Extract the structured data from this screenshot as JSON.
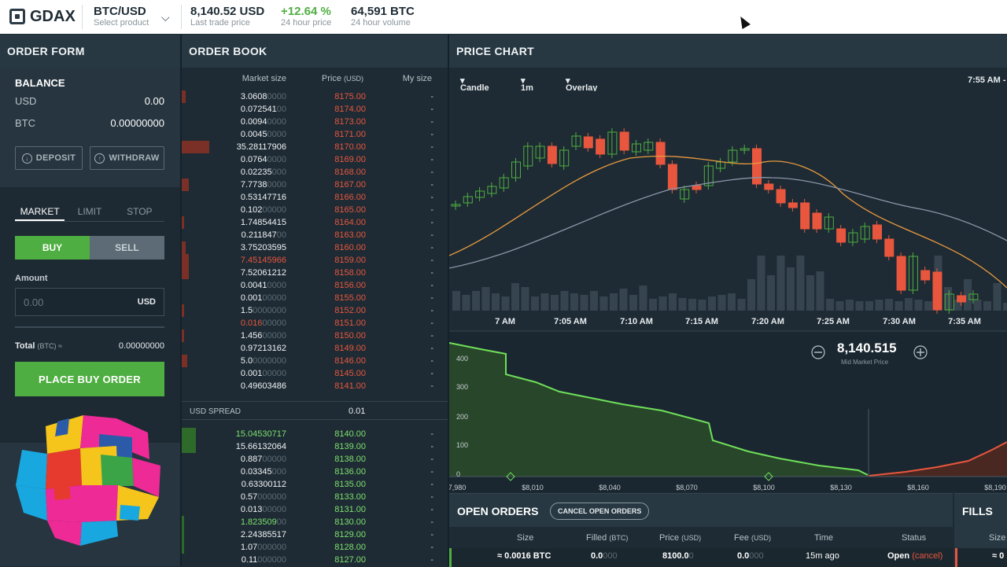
{
  "topbar": {
    "logo_text": "GDAX",
    "product": {
      "main": "BTC/USD",
      "sub": "Select product"
    },
    "last_price": {
      "main": "8,140.52 USD",
      "sub": "Last trade price"
    },
    "change": {
      "main": "+12.64 %",
      "sub": "24 hour price"
    },
    "volume": {
      "main": "64,591 BTC",
      "sub": "24 hour volume"
    }
  },
  "order_form": {
    "title": "ORDER FORM",
    "balance_title": "BALANCE",
    "usd_label": "USD",
    "usd_value": "0.00",
    "btc_label": "BTC",
    "btc_value": "0.00000000",
    "deposit_label": "DEPOSIT",
    "withdraw_label": "WITHDRAW",
    "tabs": [
      "MARKET",
      "LIMIT",
      "STOP"
    ],
    "buy_label": "BUY",
    "sell_label": "SELL",
    "amount_label": "Amount",
    "amount_placeholder": "0.00",
    "amount_unit": "USD",
    "total_label": "Total",
    "total_unit": "(BTC) ≈",
    "total_value": "0.00000000",
    "place_label": "PLACE BUY ORDER"
  },
  "order_book": {
    "title": "ORDER BOOK",
    "headers": {
      "size": "Market size",
      "price": "Price",
      "price_unit": "(USD)",
      "my": "My size"
    },
    "asks": [
      {
        "size": "3.0608",
        "pad": "0000",
        "price": "8175.00",
        "bar": 0.02
      },
      {
        "size": "0.072541",
        "pad": "00",
        "price": "8174.00",
        "bar": 0
      },
      {
        "size": "0.0094",
        "pad": "0000",
        "price": "8173.00",
        "bar": 0
      },
      {
        "size": "0.0045",
        "pad": "0000",
        "price": "8171.00",
        "bar": 0
      },
      {
        "size": "35.28117906",
        "pad": "",
        "price": "8170.00",
        "bar": 0.15
      },
      {
        "size": "0.0764",
        "pad": "0000",
        "price": "8169.00",
        "bar": 0
      },
      {
        "size": "0.02235",
        "pad": "000",
        "price": "8168.00",
        "bar": 0
      },
      {
        "size": "7.7738",
        "pad": "0000",
        "price": "8167.00",
        "bar": 0.04
      },
      {
        "size": "0.53147716",
        "pad": "",
        "price": "8166.00",
        "bar": 0
      },
      {
        "size": "0.102",
        "pad": "00000",
        "price": "8165.00",
        "bar": 0
      },
      {
        "size": "1.74854415",
        "pad": "",
        "price": "8164.00",
        "bar": 0.01
      },
      {
        "size": "0.211847",
        "pad": "00",
        "price": "8163.00",
        "bar": 0
      },
      {
        "size": "3.75203595",
        "pad": "",
        "price": "8160.00",
        "bar": 0.02
      },
      {
        "size": "7.45145966",
        "pad": "",
        "price": "8159.00",
        "bar": 0.04,
        "hl": true
      },
      {
        "size": "7.52061212",
        "pad": "",
        "price": "8158.00",
        "bar": 0.04
      },
      {
        "size": "0.0041",
        "pad": "0000",
        "price": "8156.00",
        "bar": 0
      },
      {
        "size": "0.001",
        "pad": "00000",
        "price": "8155.00",
        "bar": 0
      },
      {
        "size": "1.5",
        "pad": "0000000",
        "price": "8152.00",
        "bar": 0.01
      },
      {
        "size": "0.016",
        "pad": "00000",
        "price": "8151.00",
        "bar": 0,
        "hl": true
      },
      {
        "size": "1.456",
        "pad": "00000",
        "price": "8150.00",
        "bar": 0.01
      },
      {
        "size": "0.97213162",
        "pad": "",
        "price": "8149.00",
        "bar": 0
      },
      {
        "size": "5.0",
        "pad": "0000000",
        "price": "8146.00",
        "bar": 0.03
      },
      {
        "size": "0.001",
        "pad": "00000",
        "price": "8145.00",
        "bar": 0
      },
      {
        "size": "0.49603486",
        "pad": "",
        "price": "8141.00",
        "bar": 0
      }
    ],
    "spread_label": "USD SPREAD",
    "spread_value": "0.01",
    "bids": [
      {
        "size": "15.04530717",
        "pad": "",
        "price": "8140.00",
        "bar": 0.08,
        "hl": true
      },
      {
        "size": "15.66132064",
        "pad": "",
        "price": "8139.00",
        "bar": 0.08
      },
      {
        "size": "0.887",
        "pad": "00000",
        "price": "8138.00",
        "bar": 0
      },
      {
        "size": "0.03345",
        "pad": "000",
        "price": "8136.00",
        "bar": 0
      },
      {
        "size": "0.63300112",
        "pad": "",
        "price": "8135.00",
        "bar": 0
      },
      {
        "size": "0.57",
        "pad": "000000",
        "price": "8133.00",
        "bar": 0
      },
      {
        "size": "0.013",
        "pad": "00000",
        "price": "8131.00",
        "bar": 0
      },
      {
        "size": "1.823509",
        "pad": "00",
        "price": "8130.00",
        "bar": 0.01,
        "hl": true
      },
      {
        "size": "2.24385517",
        "pad": "",
        "price": "8129.00",
        "bar": 0.01
      },
      {
        "size": "1.07",
        "pad": "000000",
        "price": "8128.00",
        "bar": 0.01
      },
      {
        "size": "0.11",
        "pad": "000000",
        "price": "8127.00",
        "bar": 0
      }
    ],
    "my_size": "-"
  },
  "price_chart": {
    "title": "PRICE CHART",
    "toolbar": {
      "type": "Candle",
      "interval": "1m",
      "overlay": "Overlay",
      "time": "7:55 AM -"
    },
    "time_labels": [
      "7 AM",
      "7:05 AM",
      "7:10 AM",
      "7:15 AM",
      "7:20 AM",
      "7:25 AM",
      "7:30 AM",
      "7:35 AM"
    ],
    "depth": {
      "mid_price": "8,140.515",
      "mid_label": "Mid Market Price",
      "y_labels": [
        "400",
        "300",
        "200",
        "100",
        "0"
      ],
      "x_labels": [
        "7,980",
        "$8,010",
        "$8,040",
        "$8,070",
        "$8,100",
        "$8,130",
        "$8,160",
        "$8,190"
      ]
    },
    "colors": {
      "up": "#4fae41",
      "down": "#e8563e",
      "ema1": "#e89a3e",
      "ema2": "#8a96a8"
    }
  },
  "open_orders": {
    "title": "OPEN ORDERS",
    "cancel_label": "CANCEL OPEN ORDERS",
    "headers": {
      "size": "Size",
      "filled": "Filled",
      "filled_unit": "(BTC)",
      "price": "Price",
      "price_unit": "(USD)",
      "fee": "Fee",
      "fee_unit": "(USD)",
      "time": "Time",
      "status": "Status"
    },
    "row": {
      "size": "≈ 0.0016 BTC",
      "filled": "0.0",
      "filled_pad": "000",
      "price": "8100.0",
      "price_pad": "0",
      "fee": "0.0",
      "fee_pad": "000",
      "time": "15m ago",
      "status": "Open",
      "cancel": "(cancel)"
    }
  },
  "fills": {
    "title": "FILLS",
    "partial_header": "Size",
    "partial_value": "≈ 0"
  }
}
